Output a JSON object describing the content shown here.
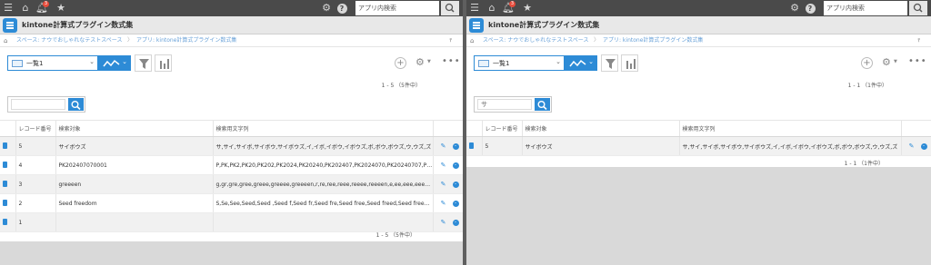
{
  "topbar": {
    "notifications_count": "3",
    "search_placeholder": "アプリ内検索"
  },
  "app": {
    "title": "kintone計算式プラグイン数式集"
  },
  "breadcrumb": {
    "space": "スペース: ナウでおしゃれなテストスペース",
    "app": "アプリ: kintone計算式プラグイン数式集"
  },
  "view": {
    "selected": "一覧1"
  },
  "columns": [
    "レコード番号",
    "検索対象",
    "検索用文字列"
  ],
  "left": {
    "count_top": "1 - 5 （5件中）",
    "count_bottom": "1 - 5 （5件中）",
    "search_value": "",
    "rows": [
      {
        "id": "5",
        "target": "サイボウズ",
        "str": "サ,サイ,サイボ,サイボウ,サイボウズ,イ,イボ,イボウ,イボウズ,ボ,ボウ,ボウズ,ウ,ウズ,ズ"
      },
      {
        "id": "4",
        "target": "PK202407070001",
        "str": "P,PK,PK2,PK20,PK202,PK2024,PK20240,PK202407,PK2024070,PK20240707,PK202…"
      },
      {
        "id": "3",
        "target": "greeeen",
        "str": "g,gr,gre,gree,greee,greeee,greeeen,r,re,ree,reee,reeee,reeeen,e,ee,eee,eeee,eeeen…"
      },
      {
        "id": "2",
        "target": "Seed freedom",
        "str": "S,Se,See,Seed,Seed ,Seed f,Seed fr,Seed fre,Seed free,Seed freed,Seed freedo,See…"
      },
      {
        "id": "1",
        "target": "",
        "str": ""
      }
    ]
  },
  "right": {
    "count_top": "1 - 1 （1件中）",
    "count_bottom": "1 - 1 （1件中）",
    "search_value": "サ",
    "rows": [
      {
        "id": "5",
        "target": "サイボウズ",
        "str": "サ,サイ,サイボ,サイボウ,サイボウズ,イ,イボ,イボウ,イボウズ,ボ,ボウ,ボウズ,ウ,ウズ,ズ"
      }
    ]
  },
  "colors": {
    "accent": "#2d8bd6",
    "topbar": "#4a4a4a"
  }
}
